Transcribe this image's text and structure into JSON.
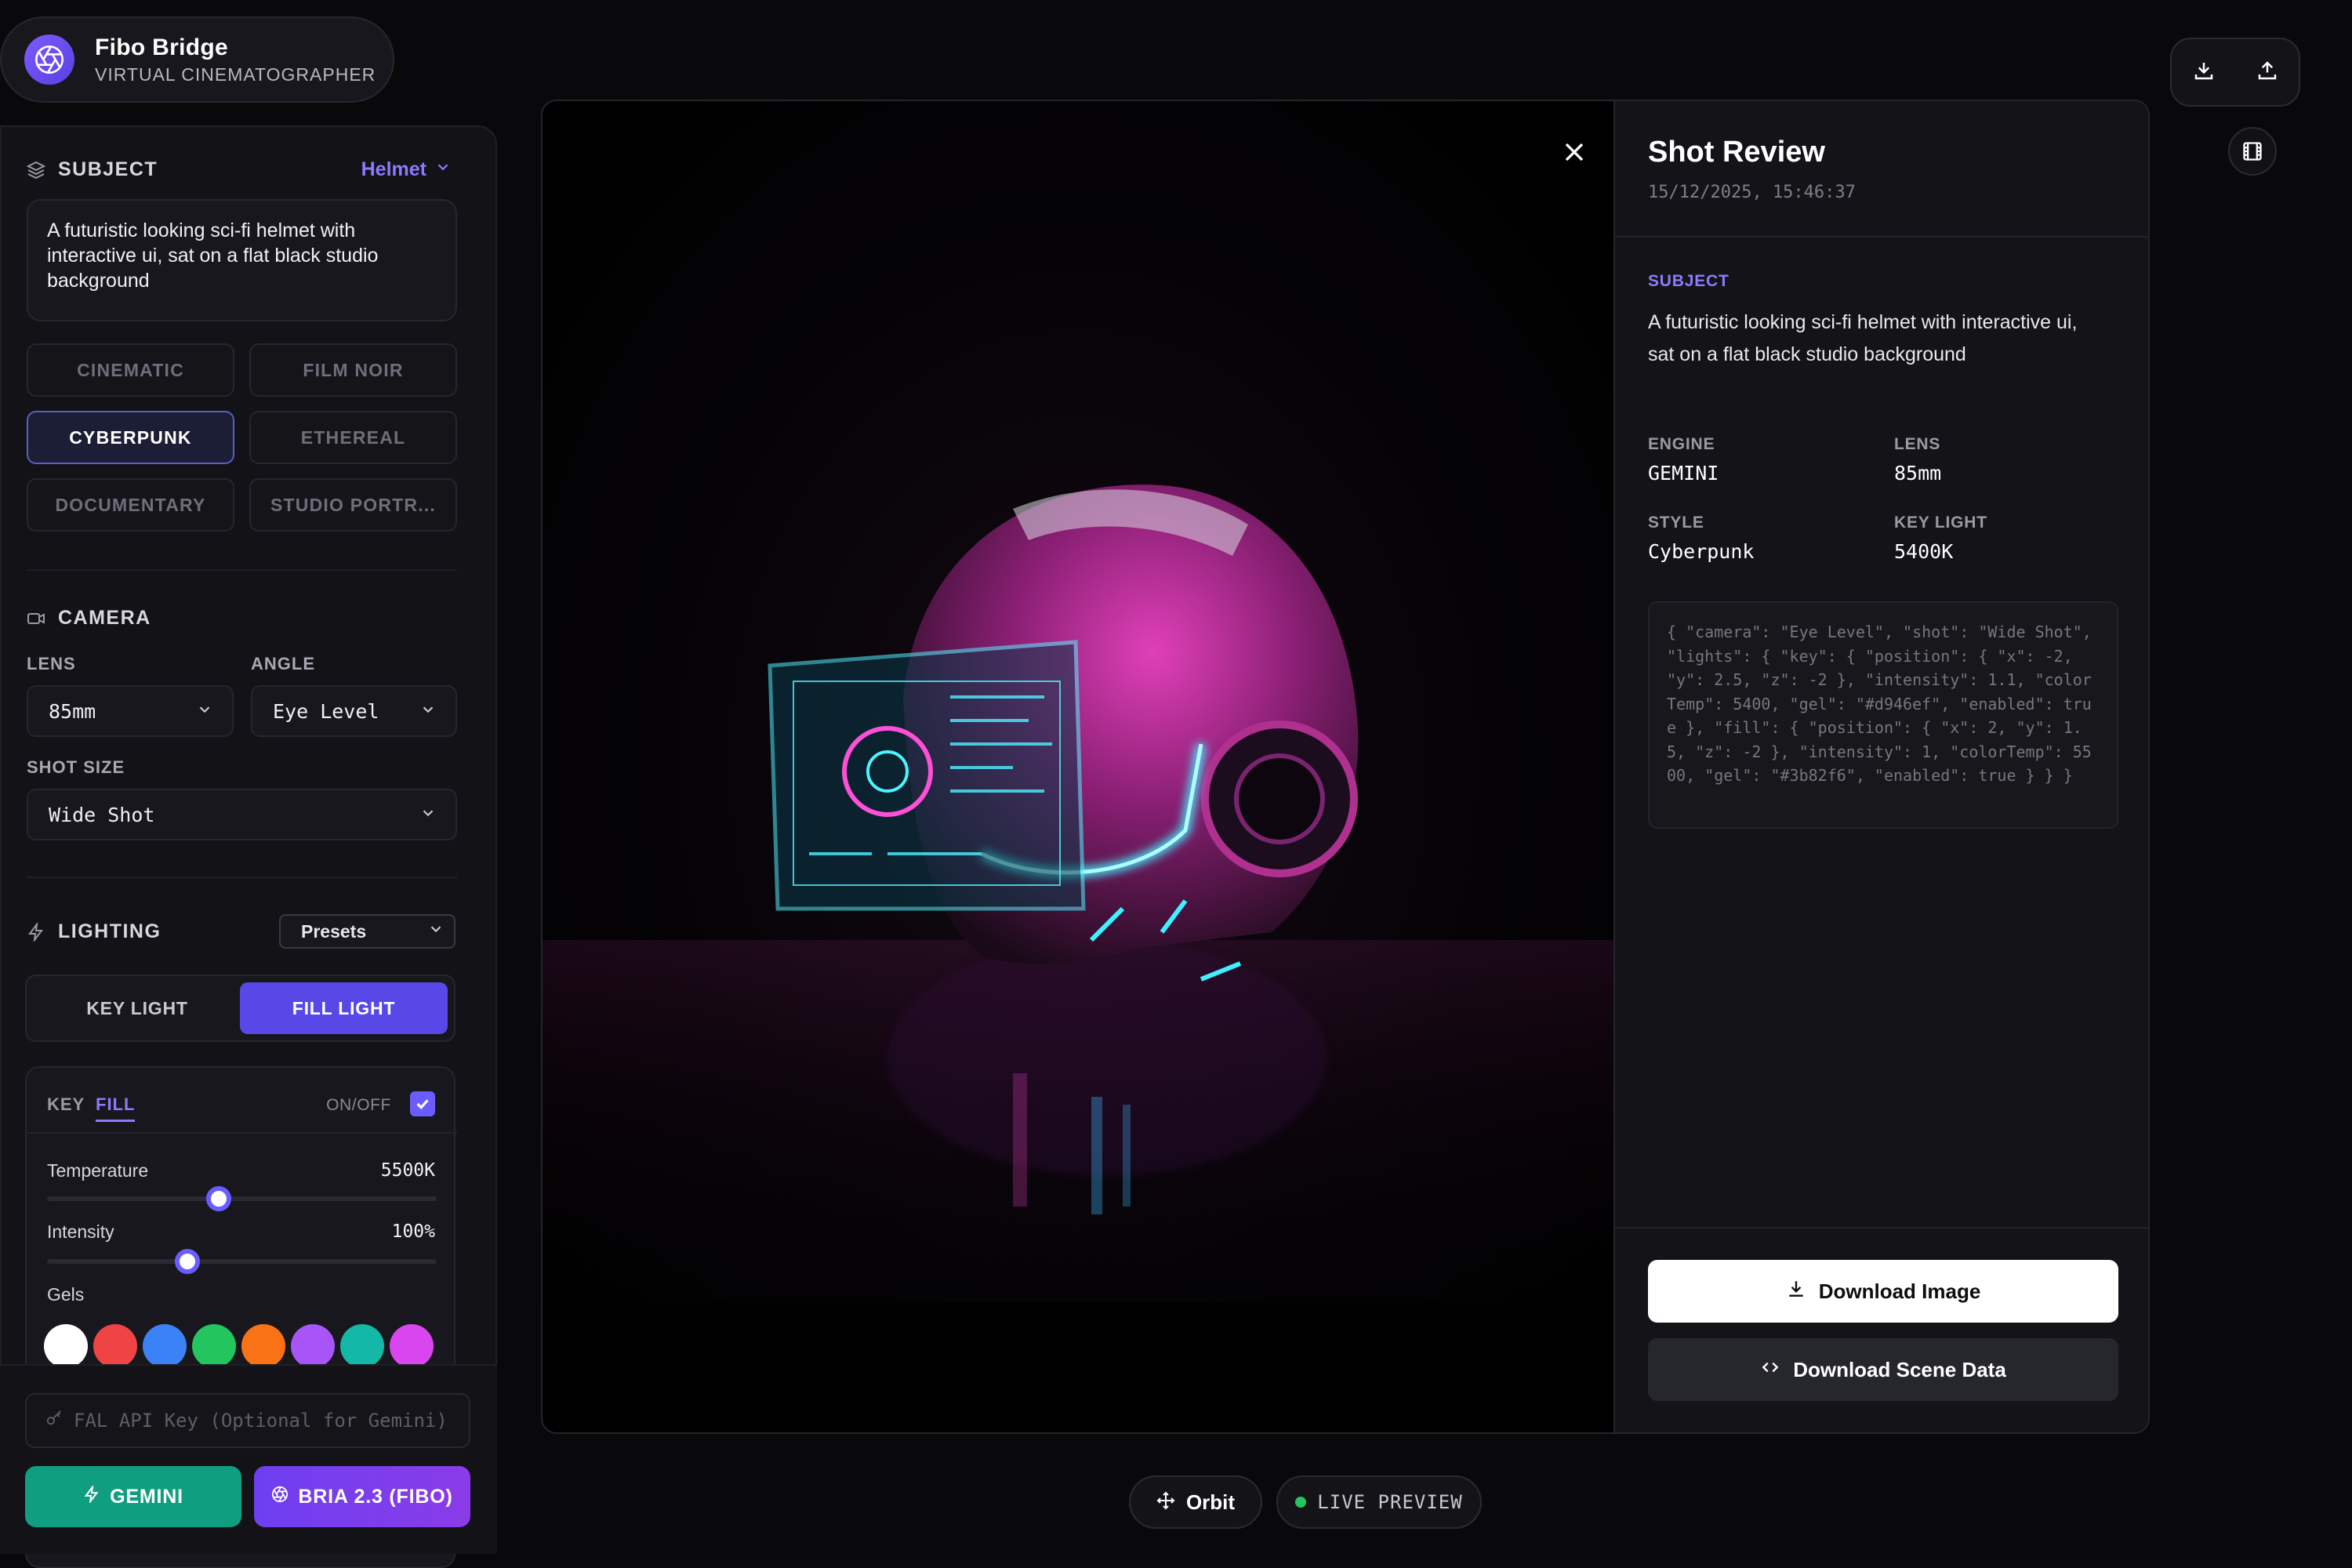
{
  "brand": {
    "title": "Fibo Bridge",
    "subtitle": "VIRTUAL CINEMATOGRAPHER",
    "logo_icon": "aperture-icon"
  },
  "subject": {
    "section_label": "SUBJECT",
    "selected": "Helmet",
    "prompt": "A futuristic looking sci-fi helmet with interactive ui, sat on a flat black studio background"
  },
  "styles": {
    "items": [
      "CINEMATIC",
      "FILM NOIR",
      "CYBERPUNK",
      "ETHEREAL",
      "DOCUMENTARY",
      "STUDIO PORTR..."
    ],
    "active": "CYBERPUNK"
  },
  "camera": {
    "section_label": "CAMERA",
    "lens_label": "LENS",
    "lens_value": "85mm",
    "angle_label": "ANGLE",
    "angle_value": "Eye Level",
    "shot_label": "SHOT SIZE",
    "shot_value": "Wide Shot"
  },
  "lighting": {
    "section_label": "LIGHTING",
    "presets_label": "Presets",
    "seg_key": "KEY LIGHT",
    "seg_fill": "FILL LIGHT",
    "tab_key": "KEY",
    "tab_fill": "FILL",
    "onoff_label": "ON/OFF",
    "enabled": true,
    "temperature_label": "Temperature",
    "temperature_value": "5500K",
    "temperature_fraction": 0.44,
    "intensity_label": "Intensity",
    "intensity_value": "100%",
    "intensity_fraction": 0.36,
    "gels_label": "Gels",
    "gel_colors": [
      "#ffffff",
      "#ef4444",
      "#3b82f6",
      "#22c55e",
      "#f97316",
      "#a855f7",
      "#14b8a6",
      "#d946ef"
    ]
  },
  "api": {
    "placeholder": "FAL API Key (Optional for Gemini)"
  },
  "engines": {
    "gemini": "GEMINI",
    "bria": "BRIA 2.3 (FIBO)"
  },
  "review": {
    "title": "Shot Review",
    "timestamp": "15/12/2025, 15:46:37",
    "subject_label": "SUBJECT",
    "subject_text": "A futuristic looking sci-fi helmet with interactive ui, sat on a flat black studio background",
    "engine_label": "ENGINE",
    "engine_value": "GEMINI",
    "lens_label": "LENS",
    "lens_value": "85mm",
    "style_label": "STYLE",
    "style_value": "Cyberpunk",
    "keylight_label": "KEY LIGHT",
    "keylight_value": "5400K",
    "json": "{ \"camera\": \"Eye Level\", \"shot\": \"Wide Shot\", \"lights\": { \"key\": { \"position\": { \"x\": -2, \"y\": 2.5, \"z\": -2 }, \"intensity\": 1.1, \"colorTemp\": 5400, \"gel\": \"#d946ef\", \"enabled\": true }, \"fill\": { \"position\": { \"x\": 2, \"y\": 1.5, \"z\": -2 }, \"intensity\": 1, \"colorTemp\": 5500, \"gel\": \"#3b82f6\", \"enabled\": true } } }",
    "download_image": "Download Image",
    "download_scene": "Download Scene Data"
  },
  "footer": {
    "orbit": "Orbit",
    "live_preview": "LIVE PREVIEW"
  },
  "colors": {
    "accent": "#5848e8",
    "accent_light": "#8b7bff",
    "gemini": "#0f9f80",
    "live_dot": "#22c55e"
  }
}
